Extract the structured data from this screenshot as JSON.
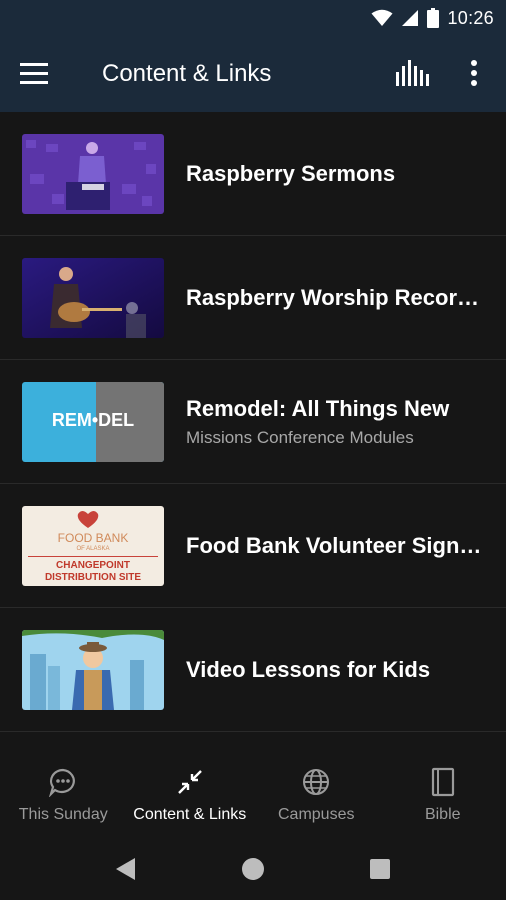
{
  "status_bar": {
    "time": "10:26",
    "icons": [
      "wifi-icon",
      "signal-icon",
      "battery-icon"
    ]
  },
  "app_bar": {
    "title": "Content & Links",
    "icons": [
      "menu-icon",
      "audio-bars-icon",
      "more-vert-icon"
    ]
  },
  "list": {
    "items": [
      {
        "title": "Raspberry Sermons",
        "subtitle": ""
      },
      {
        "title": "Raspberry Worship Recor…",
        "subtitle": ""
      },
      {
        "title": "Remodel: All Things New",
        "subtitle": "Missions Conference Modules"
      },
      {
        "title": "Food Bank Volunteer Sign…",
        "subtitle": ""
      },
      {
        "title": "Video Lessons for Kids",
        "subtitle": ""
      }
    ]
  },
  "thumbnails": {
    "remodel_text": "REM•DEL",
    "food_bank_text": "FOOD BANK",
    "food_bank_small": "OF ALASKA",
    "food_bank_site_1": "CHANGEPOINT",
    "food_bank_site_2": "DISTRIBUTION SITE"
  },
  "bottom_nav": {
    "tabs": [
      {
        "label": "This Sunday",
        "icon": "chat-bubble-icon",
        "active": false
      },
      {
        "label": "Content & Links",
        "icon": "collapse-arrows-icon",
        "active": true
      },
      {
        "label": "Campuses",
        "icon": "globe-icon",
        "active": false
      },
      {
        "label": "Bible",
        "icon": "book-icon",
        "active": false
      }
    ]
  },
  "colors": {
    "app_bar": "#1b2a3a",
    "background": "#161616",
    "divider": "#2a2a2a",
    "text_primary": "#ffffff",
    "text_secondary": "#a8a8a8",
    "nav_inactive": "#9a9a9a"
  }
}
